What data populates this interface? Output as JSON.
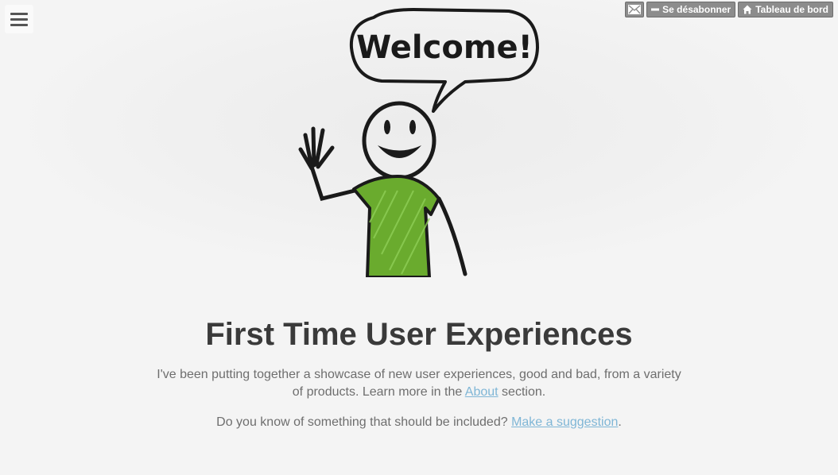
{
  "menu": {
    "icon": "hamburger-icon"
  },
  "topbar": {
    "mail_icon": "mail-icon",
    "unsubscribe_label": "Se désabonner",
    "unsubscribe_icon": "minus-icon",
    "dashboard_label": "Tableau de bord",
    "dashboard_icon": "home-icon"
  },
  "hero": {
    "speech_bubble_text": "Welcome!",
    "shirt_color": "#6aab2e"
  },
  "main": {
    "title": "First Time User Experiences",
    "intro_text": "I've been putting together a showcase of new user experiences, good and bad, from a variety of products. Learn more in the ",
    "about_link": "About",
    "intro_suffix": " section.",
    "question_text": "Do you know of something that should be included? ",
    "suggestion_link": "Make a suggestion",
    "question_suffix": "."
  },
  "colors": {
    "link": "#7fb6d6",
    "title": "#3a3a3a",
    "body_text": "#6e6e6e"
  }
}
